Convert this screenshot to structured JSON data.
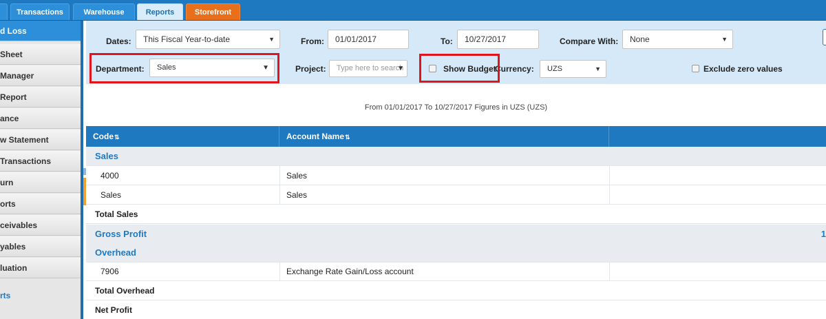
{
  "topbar": {
    "tabs": [
      {
        "label": "",
        "active": false
      },
      {
        "label": "Transactions",
        "active": false
      },
      {
        "label": "Warehouse",
        "active": false
      },
      {
        "label": "Reports",
        "active": true
      },
      {
        "label": "Storefront",
        "active": false
      }
    ]
  },
  "sidebar": {
    "items": [
      {
        "label": "d Loss",
        "active": true
      },
      {
        "label": " Sheet"
      },
      {
        "label": "Manager"
      },
      {
        "label": "Report"
      },
      {
        "label": "ance"
      },
      {
        "label": "w Statement"
      },
      {
        "label": " Transactions"
      },
      {
        "label": "urn"
      },
      {
        "label": "orts"
      },
      {
        "label": "ceivables"
      },
      {
        "label": "yables"
      },
      {
        "label": "luation"
      }
    ],
    "link_label": "rts"
  },
  "filters": {
    "dates_label": "Dates:",
    "dates_value": "This Fiscal Year-to-date",
    "from_label": "From:",
    "from_value": "01/01/2017",
    "to_label": "To:",
    "to_value": "10/27/2017",
    "compare_label": "Compare With:",
    "compare_value": "None",
    "department_label": "Department:",
    "department_value": "Sales",
    "project_label": "Project:",
    "project_placeholder": "Type here to search",
    "show_budget_label": "Show Budget",
    "currency_label": "Currency:",
    "currency_value": "UZS",
    "exclude_zero_label": "Exclude zero values"
  },
  "report": {
    "subtitle": "From 01/01/2017 To 10/27/2017 Figures in UZS (UZS)"
  },
  "table": {
    "columns": [
      {
        "label": "Code"
      },
      {
        "label": "Account Name"
      }
    ],
    "rows": [
      {
        "type": "group",
        "title": "Sales"
      },
      {
        "type": "data",
        "code": "4000",
        "name": "Sales"
      },
      {
        "type": "data",
        "code": "Sales",
        "name": "Sales"
      },
      {
        "type": "total",
        "title": "Total Sales"
      },
      {
        "type": "group",
        "title": "Gross Profit",
        "value": "1"
      },
      {
        "type": "group",
        "title": "Overhead"
      },
      {
        "type": "data",
        "code": "7906",
        "name": "Exchange Rate Gain/Loss account"
      },
      {
        "type": "total",
        "title": "Total Overhead"
      },
      {
        "type": "total",
        "title": "Net Profit"
      }
    ]
  },
  "colors": {
    "brand_blue": "#1f79c1",
    "filter_panel": "#d6e9f8",
    "storefront_tab": "#e86f1c",
    "highlight_red": "#e0141b"
  }
}
